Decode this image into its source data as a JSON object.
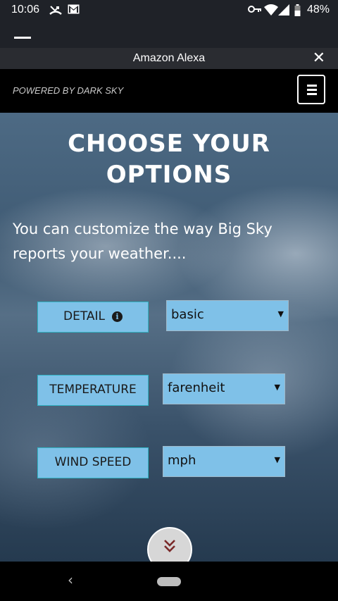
{
  "status_bar": {
    "time": "10:06",
    "battery": "48%",
    "icons": [
      "missed-call-icon",
      "gmail-icon",
      "vpn-key-icon",
      "wifi-icon",
      "signal-icon",
      "battery-icon"
    ]
  },
  "modal": {
    "title": "Amazon Alexa",
    "close_glyph": "✕"
  },
  "header": {
    "powered_by": "POWERED BY DARK SKY"
  },
  "hero": {
    "headline_line1": "CHOOSE YOUR",
    "headline_line2": "OPTIONS",
    "subtext": "You can customize the way Big Sky reports your weather...."
  },
  "options": [
    {
      "label": "DETAIL",
      "value": "basic",
      "has_info": true
    },
    {
      "label": "TEMPERATURE",
      "value": "farenheit",
      "has_info": false
    },
    {
      "label": "WIND SPEED",
      "value": "mph",
      "has_info": false
    }
  ],
  "colors": {
    "option_bg": "#7fc1e8",
    "label_border": "#2fb3c4",
    "scroll_chevron": "#7a2a2a"
  }
}
